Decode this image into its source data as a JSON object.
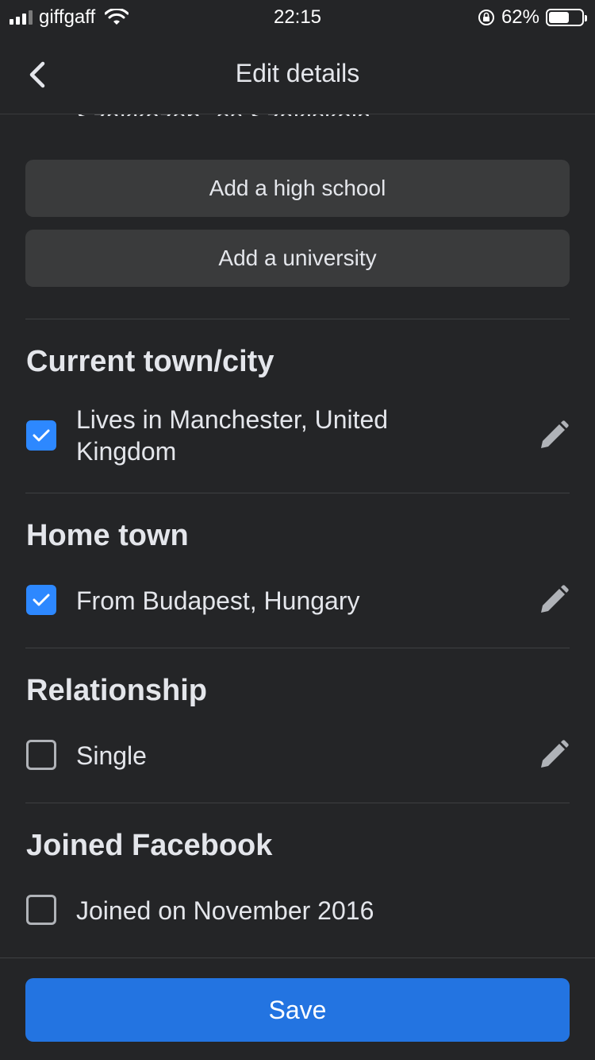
{
  "status_bar": {
    "carrier": "giffgaff",
    "time": "22:15",
    "battery": "62%",
    "battery_level": 0.62
  },
  "nav": {
    "title": "Edit details"
  },
  "education": {
    "partial_item": "Szakközép- és Szakiskola",
    "add_high_school": "Add a high school",
    "add_university": "Add a university"
  },
  "sections": {
    "current_town": {
      "title": "Current town/city",
      "item": "Lives in Manchester, United Kingdom",
      "checked": true
    },
    "home_town": {
      "title": "Home town",
      "item": "From Budapest, Hungary",
      "checked": true
    },
    "relationship": {
      "title": "Relationship",
      "item": "Single",
      "checked": false
    },
    "joined": {
      "title": "Joined Facebook",
      "item": "Joined on November 2016",
      "checked": false
    }
  },
  "footer": {
    "save_label": "Save"
  },
  "colors": {
    "background": "#242527",
    "accent": "#2d88ff",
    "save_button": "#2374e1",
    "gray_button": "#3a3b3c"
  }
}
